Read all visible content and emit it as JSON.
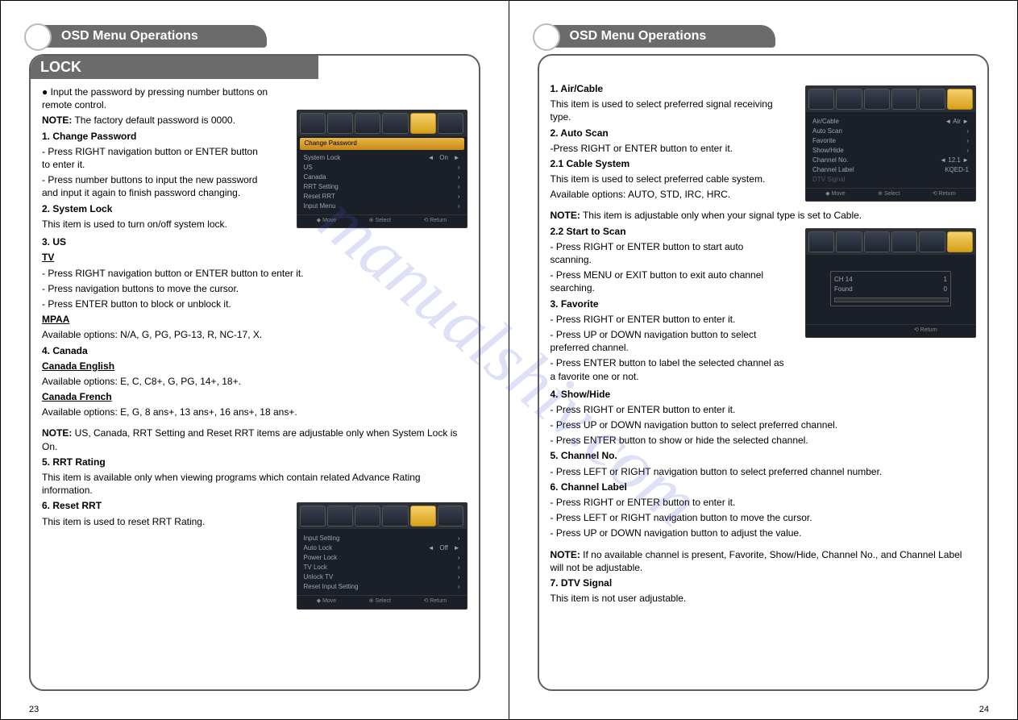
{
  "watermark": "manualshiv.com",
  "left": {
    "chapter": "OSD Menu Operations",
    "section": "LOCK",
    "intro_bullet": "Input the password by pressing number buttons on remote control.",
    "intro_note_label": "NOTE:",
    "intro_note": " The factory default password is 0000.",
    "s1_h": "1. Change Password",
    "s1_l1": "- Press RIGHT navigation button or ENTER button to enter it.",
    "s1_l2": "- Press number buttons to input the new password and input it again to finish password changing.",
    "s2_h": "2. System Lock",
    "s2_l1": "This item is used to turn on/off system lock.",
    "s3_h": "3. US",
    "s3_tv": "TV",
    "s3_tv_l1": "- Press RIGHT navigation button or ENTER button to enter it.",
    "s3_tv_l2": "- Press navigation buttons to move the cursor.",
    "s3_tv_l3": "- Press ENTER button to block or unblock it.",
    "s3_mpaa": "MPAA",
    "s3_mpaa_l1": "Available options: N/A, G, PG, PG-13, R, NC-17, X.",
    "s4_h": "4. Canada",
    "s4_ce": "Canada English",
    "s4_ce_l1": "Available options: E, C, C8+, G, PG, 14+, 18+.",
    "s4_cf": "Canada French",
    "s4_cf_l1": "Available options: E, G, 8 ans+, 13 ans+, 16 ans+, 18 ans+.",
    "note2_label": "NOTE:",
    "note2": " US, Canada, RRT Setting and Reset RRT items are adjustable only when System Lock is On.",
    "s5_h": "5. RRT Rating",
    "s5_l1": "This item is available only when viewing programs which contain related Advance Rating information.",
    "s6_h": "6. Reset RRT",
    "s6_l1": "This item is used to reset RRT Rating.",
    "osd1_title": "Change Password",
    "osd1_rows": [
      "System Lock",
      "US",
      "Canada",
      "RRT Setting",
      "Reset RRT",
      "Input Menu"
    ],
    "osd2_rows": [
      "Input Setting",
      "Auto Lock",
      "Power Lock",
      "TV Lock",
      "Unlock TV",
      "Reset Input Setting"
    ],
    "pagenum": "23"
  },
  "right": {
    "chapter": "OSD Menu Operations",
    "s1_h": "1. Air/Cable",
    "s1_l1": "This item is used to select preferred signal receiving type.",
    "s2_h": "2. Auto Scan",
    "s2_l1": "-Press RIGHT or ENTER button to enter it.",
    "s21_h": "2.1 Cable System",
    "s21_l1": "This item is used to select preferred cable system.",
    "s21_l2": "Available options: AUTO, STD, IRC, HRC.",
    "s21_note_label": "NOTE:",
    "s21_note": " This item is adjustable only when your signal type is set to Cable.",
    "s22_h": "2.2 Start to Scan",
    "s22_l1": "- Press RIGHT or ENTER button to start auto scanning.",
    "s22_l2": "- Press MENU or EXIT button to exit auto channel searching.",
    "s3_h": "3. Favorite",
    "s3_l1": "- Press RIGHT or ENTER button to enter it.",
    "s3_l2": "- Press UP or DOWN navigation button to select preferred channel.",
    "s3_l3": "- Press ENTER button to label the selected channel as a favorite one or not.",
    "s4_h": "4. Show/Hide",
    "s4_l1": "- Press RIGHT or ENTER button to enter it.",
    "s4_l2": "- Press UP or DOWN navigation button to select preferred channel.",
    "s4_l3": "- Press ENTER button to show or hide the selected channel.",
    "s5_h": "5. Channel No.",
    "s5_l1": "- Press LEFT or RIGHT navigation button to select preferred channel number.",
    "s6_h": "6. Channel Label",
    "s6_l1": "- Press RIGHT or ENTER button to enter it.",
    "s6_l2": "- Press LEFT or RIGHT navigation button to move the cursor.",
    "s6_l3": "- Press UP or DOWN navigation button to adjust the value.",
    "note_label": "NOTE:",
    "note": " If no available channel is present, Favorite, Show/Hide, Channel No., and Channel Label will not be adjustable.",
    "s7_h": "7. DTV Signal",
    "s7_l1": "This item is not user adjustable.",
    "osd1_rows_l": [
      "Air/Cable",
      "Auto Scan",
      "Favorite",
      "Show/Hide",
      "Channel No.",
      "Channel Label",
      "DTV Signal"
    ],
    "osd1_rows_r": [
      "Air",
      "",
      "",
      "",
      "12.1",
      "KQED-1",
      ""
    ],
    "pagenum": "24"
  }
}
